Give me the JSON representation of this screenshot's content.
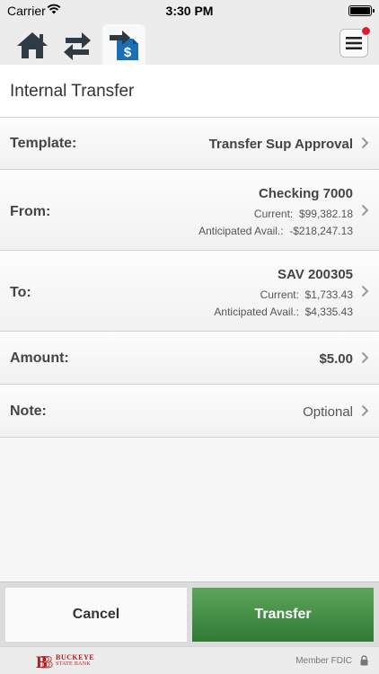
{
  "status_bar": {
    "carrier": "Carrier",
    "time": "3:30 PM"
  },
  "toolbar": {
    "icons": [
      "home-icon",
      "transfer-arrows-icon",
      "transfer-dollar-icon",
      "menu-icon"
    ],
    "active_tab": "transfer-dollar-icon",
    "accent_color": "#1a6fb5",
    "badge_color": "#e21b2b"
  },
  "page": {
    "title": "Internal Transfer"
  },
  "form": {
    "template": {
      "label": "Template:",
      "value": "Transfer Sup Approval"
    },
    "from": {
      "label": "From:",
      "account": "Checking 7000",
      "current_label": "Current:",
      "current_value": "$99,382.18",
      "anticipated_label": "Anticipated Avail.:",
      "anticipated_value": "-$218,247.13"
    },
    "to": {
      "label": "To:",
      "account": "SAV 200305",
      "current_label": "Current:",
      "current_value": "$1,733.43",
      "anticipated_label": "Anticipated Avail.:",
      "anticipated_value": "$4,335.43"
    },
    "amount": {
      "label": "Amount:",
      "value": "$5.00"
    },
    "note": {
      "label": "Note:",
      "placeholder": "Optional"
    }
  },
  "actions": {
    "cancel_label": "Cancel",
    "transfer_label": "Transfer",
    "transfer_color": "#3e8a40"
  },
  "footer": {
    "bank_name_line1": "BUCKEYE",
    "bank_name_line2": "STATE BANK",
    "fdic_text": "Member FDIC",
    "brand_color": "#b71c1c"
  }
}
